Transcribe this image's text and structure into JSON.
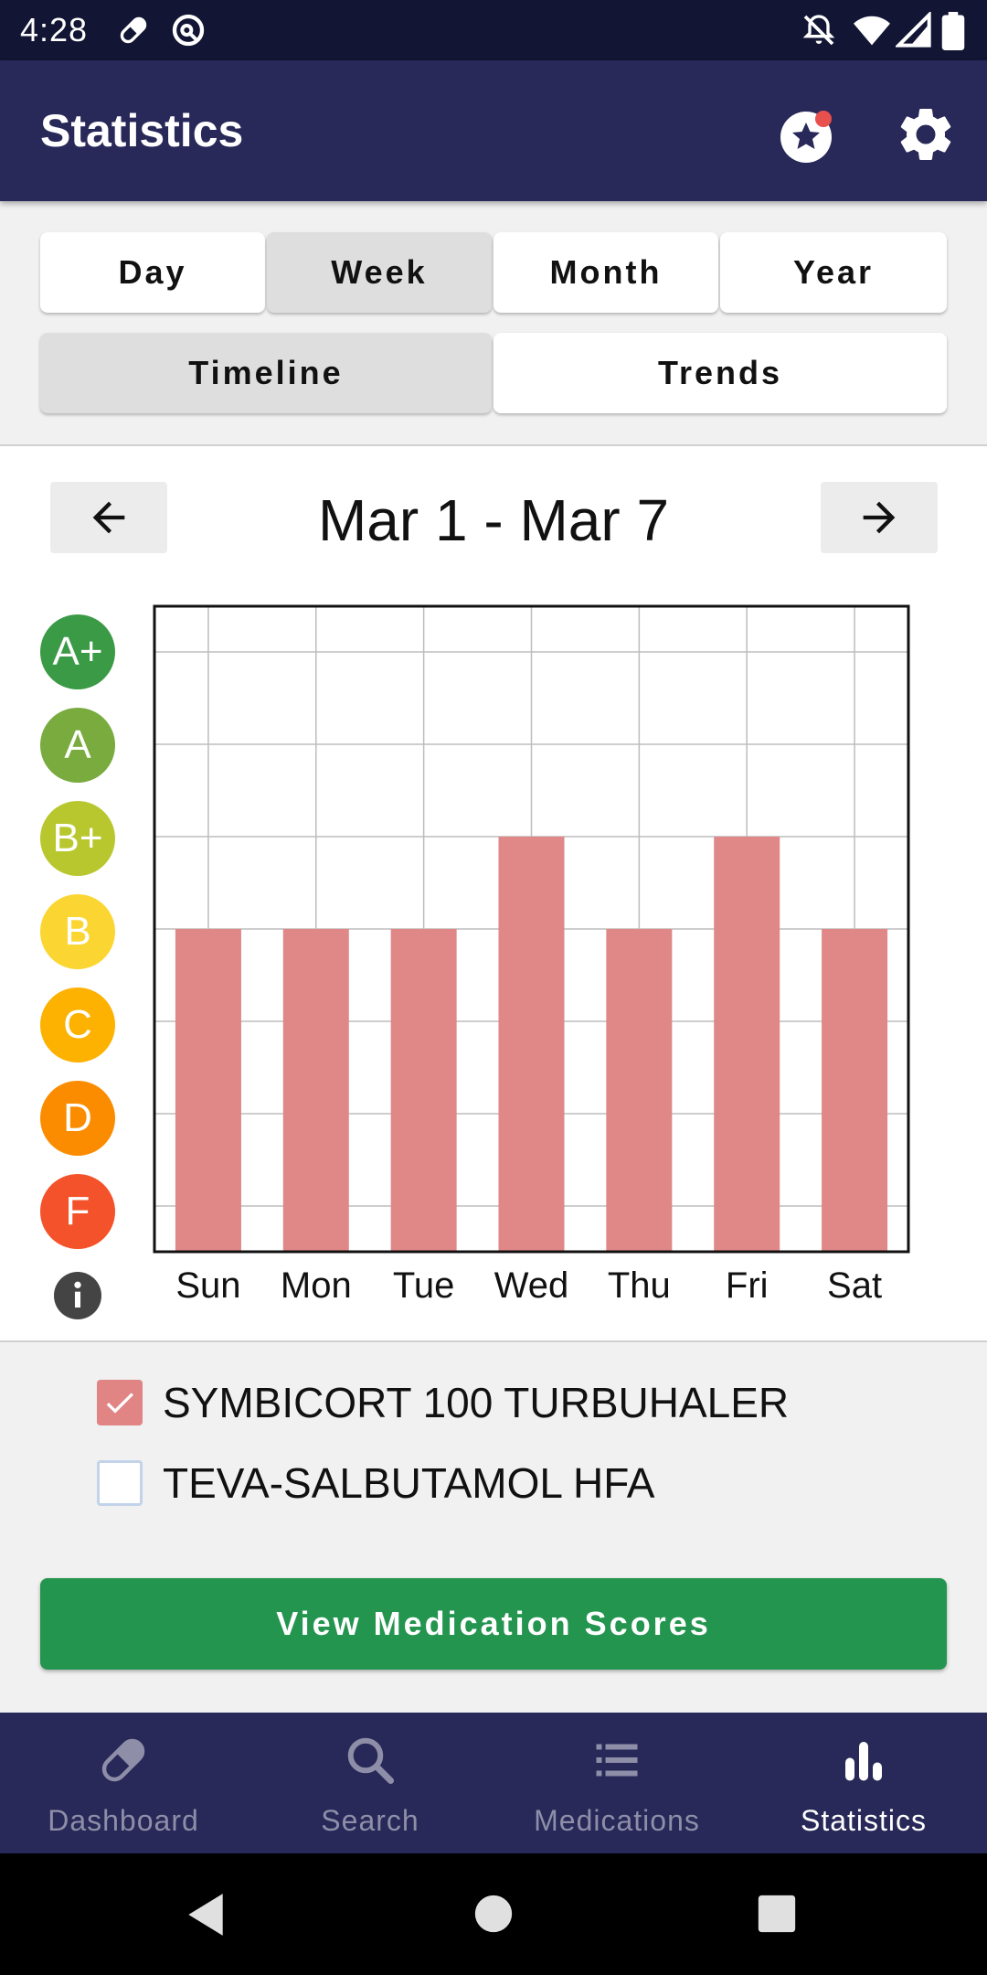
{
  "status_bar": {
    "time": "4:28",
    "left_icons": [
      "pill-icon",
      "vpn-key-icon"
    ],
    "right_icons": [
      "notifications-off-icon",
      "wifi-icon",
      "signal-icon",
      "battery-icon"
    ]
  },
  "app_bar": {
    "title": "Statistics",
    "actions": [
      "rewards-star-icon",
      "gear-icon"
    ],
    "notification_dot_color": "#e8504e"
  },
  "period_tabs": [
    {
      "label": "Day",
      "selected": false
    },
    {
      "label": "Week",
      "selected": true
    },
    {
      "label": "Month",
      "selected": false
    },
    {
      "label": "Year",
      "selected": false
    }
  ],
  "view_tabs": [
    {
      "label": "Timeline",
      "selected": true
    },
    {
      "label": "Trends",
      "selected": false
    }
  ],
  "date_nav": {
    "range": "Mar 1 - Mar 7",
    "prev_icon": "arrow-left-icon",
    "next_icon": "arrow-right-icon"
  },
  "grades": [
    {
      "label": "A+",
      "color": "#3b9a46"
    },
    {
      "label": "A",
      "color": "#79ab3e"
    },
    {
      "label": "B+",
      "color": "#b9c72f"
    },
    {
      "label": "B",
      "color": "#fbd632"
    },
    {
      "label": "C",
      "color": "#fdb100"
    },
    {
      "label": "D",
      "color": "#fb8c00"
    },
    {
      "label": "F",
      "color": "#f3522a"
    }
  ],
  "chart_data": {
    "type": "bar",
    "categories": [
      "Sun",
      "Mon",
      "Tue",
      "Wed",
      "Thu",
      "Fri",
      "Sat"
    ],
    "values": [
      "B",
      "B",
      "B",
      "B+",
      "B",
      "B+",
      "B"
    ],
    "y_categories": [
      "F",
      "D",
      "C",
      "B",
      "B+",
      "A",
      "A+"
    ],
    "bar_color": "#e08787",
    "grid": true
  },
  "medications": [
    {
      "name": "SYMBICORT 100 TURBUHALER",
      "checked": true
    },
    {
      "name": "TEVA-SALBUTAMOL HFA",
      "checked": false
    }
  ],
  "view_scores_button": "View Medication Scores",
  "bottom_nav": [
    {
      "label": "Dashboard",
      "icon": "pill-icon",
      "active": false
    },
    {
      "label": "Search",
      "icon": "search-icon",
      "active": false
    },
    {
      "label": "Medications",
      "icon": "list-icon",
      "active": false
    },
    {
      "label": "Statistics",
      "icon": "bar-chart-icon",
      "active": true
    }
  ],
  "system_nav": [
    "back-icon",
    "home-icon",
    "recents-icon"
  ]
}
